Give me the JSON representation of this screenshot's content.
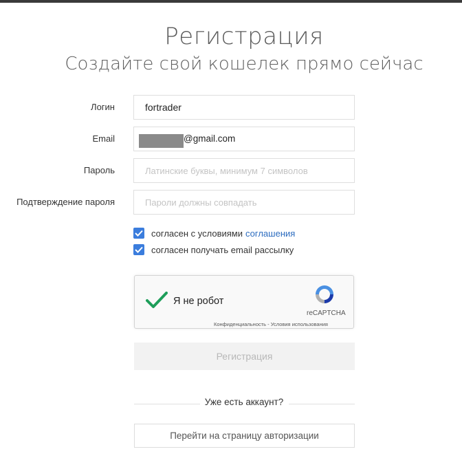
{
  "header": {
    "title": "Регистрация",
    "subtitle": "Создайте свой кошелек прямо сейчас"
  },
  "form": {
    "login": {
      "label": "Логин",
      "value": "fortrader"
    },
    "email": {
      "label": "Email",
      "value_visible": "@gmail.com"
    },
    "password": {
      "label": "Пароль",
      "placeholder": "Латинские буквы, минимум 7 символов"
    },
    "confirm": {
      "label": "Подтверждение пароля",
      "placeholder": "Пароли должны совпадать"
    },
    "terms": {
      "text": "согласен с условиями",
      "link": "соглашения",
      "checked": true
    },
    "newsletter": {
      "text": "согласен получать email рассылку",
      "checked": true
    }
  },
  "captcha": {
    "label": "Я не робот",
    "brand": "reCAPTCHA",
    "links": "Конфиденциальность - Условия использования",
    "checked": true
  },
  "submit_label": "Регистрация",
  "footer": {
    "divider_text": "Уже есть аккаунт?",
    "login_link": "Перейти на страницу авторизации"
  },
  "colors": {
    "accent": "#3b7ddd",
    "link": "#2c6cbf",
    "captcha_check": "#1e9e5a"
  }
}
